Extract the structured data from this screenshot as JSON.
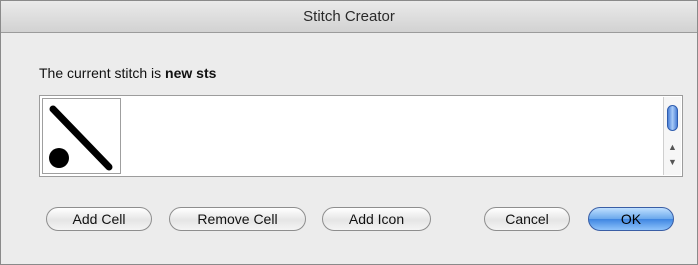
{
  "window": {
    "title": "Stitch Creator"
  },
  "prompt": {
    "prefix": "The current stitch is ",
    "stitch_name": "new sts"
  },
  "cells": [
    {
      "icon": "diagonal-stitch-with-dot-icon"
    }
  ],
  "scrollbar": {
    "up_arrow": "▲",
    "down_arrow": "▼"
  },
  "buttons": {
    "add_cell": "Add Cell",
    "remove_cell": "Remove Cell",
    "add_icon": "Add Icon",
    "cancel": "Cancel",
    "ok": "OK"
  },
  "colors": {
    "default_button": "#6aa8ec",
    "window_bg": "#ececec"
  }
}
